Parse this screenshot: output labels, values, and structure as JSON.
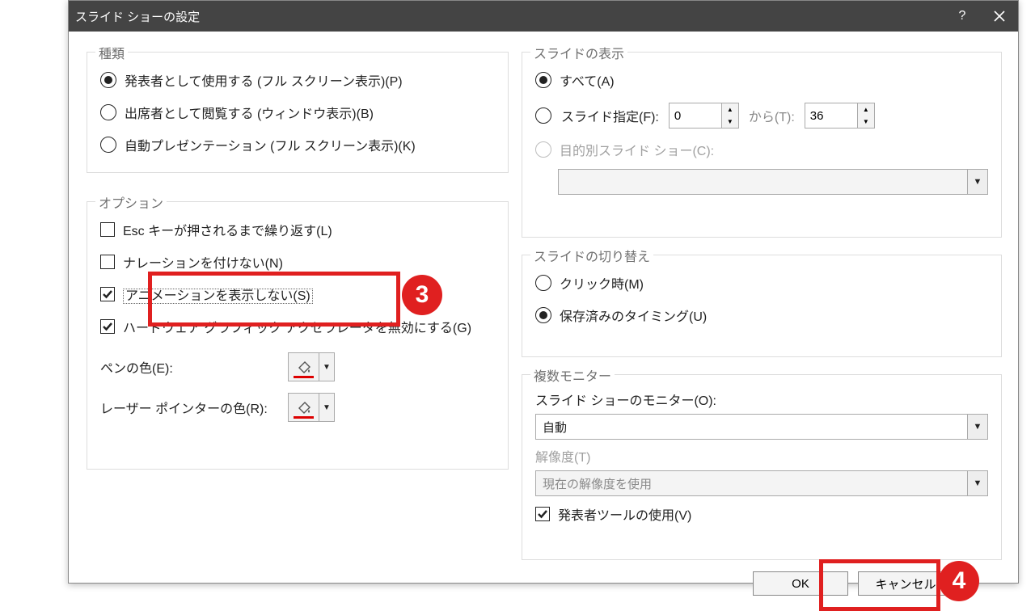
{
  "dialog": {
    "title": "スライド ショーの設定"
  },
  "groups": {
    "type_title": "種類",
    "options_title": "オプション",
    "slides_title": "スライドの表示",
    "advance_title": "スライドの切り替え",
    "monitors_title": "複数モニター"
  },
  "type": {
    "presenter": "発表者として使用する (フル スクリーン表示)(P)",
    "browse": "出席者として閲覧する (ウィンドウ表示)(B)",
    "kiosk": "自動プレゼンテーション (フル スクリーン表示)(K)"
  },
  "options": {
    "loop_esc": "Esc キーが押されるまで繰り返す(L)",
    "no_narration": "ナレーションを付けない(N)",
    "no_animation": "アニメーションを表示しない(S)",
    "disable_hw": "ハードウェア グラフィック アクセラレータを無効にする(G)",
    "pen_color_label": "ペンの色(E):",
    "laser_color_label": "レーザー ポインターの色(R):"
  },
  "slides": {
    "all": "すべて(A)",
    "from_label": "スライド指定(F):",
    "from_value": "0",
    "to_label": "から(T):",
    "to_value": "36",
    "custom_label": "目的別スライド ショー(C):",
    "custom_value": ""
  },
  "advance": {
    "manual": "クリック時(M)",
    "timings": "保存済みのタイミング(U)"
  },
  "monitors": {
    "monitor_label": "スライド ショーのモニター(O):",
    "monitor_value": "自動",
    "resolution_label": "解像度(T)",
    "resolution_value": "現在の解像度を使用",
    "presenter_view": "発表者ツールの使用(V)"
  },
  "footer": {
    "ok": "OK",
    "cancel": "キャンセル"
  },
  "annotations": {
    "step3": "3",
    "step4": "4"
  }
}
